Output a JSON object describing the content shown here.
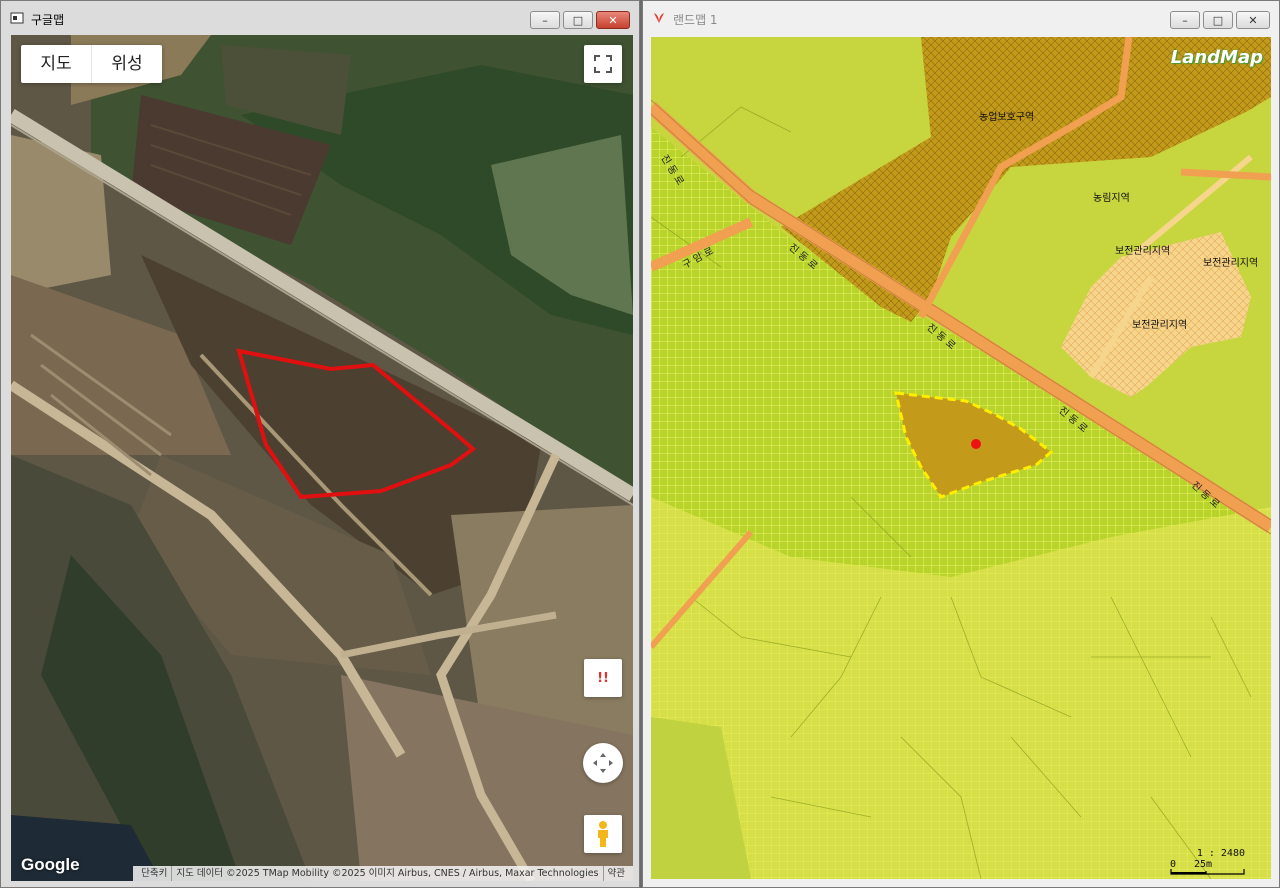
{
  "left_window": {
    "title": "구글맵",
    "map_type": {
      "map_label": "지도",
      "satellite_label": "위성"
    },
    "logo": "Google",
    "attribution": {
      "shortcuts": "단축키",
      "data": "지도 데이터 ©2025 TMap Mobility ©2025 이미지 Airbus, CNES / Airbus, Maxar Technologies",
      "terms": "약관"
    },
    "report_label": "!!",
    "colors": {
      "parcel_outline": "#e01010"
    }
  },
  "right_window": {
    "title": "랜드맵 1",
    "logo": "LandMap",
    "labels": {
      "agri_protect": "농업보호구역",
      "agri_forest": "농림지역",
      "conservation_1": "보전관리지역",
      "conservation_2": "보전관리지역",
      "conservation_3": "보전관리지역",
      "road_1": "진동로",
      "road_2": "진동로",
      "road_3": "진동로",
      "road_4": "진동로",
      "road_5": "진동로",
      "road_6": "구암로"
    },
    "scale": {
      "ratio": "1 : 2480",
      "zero": "0",
      "distance": "25m"
    },
    "colors": {
      "parcel_outline": "#ffee00",
      "marker": "#ee1111",
      "road": "#f0a050"
    }
  },
  "icons": {
    "fullscreen": "fullscreen-icon",
    "camera": "camera-control-icon",
    "pegman": "pegman-icon",
    "report": "report-icon"
  }
}
